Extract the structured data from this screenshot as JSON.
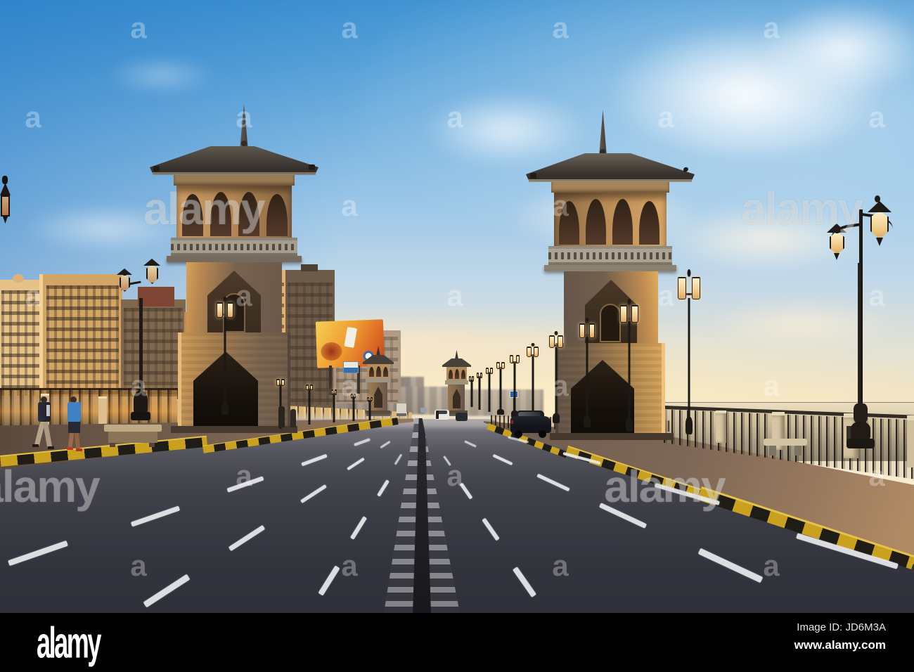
{
  "watermarks": {
    "brand_text": "alamy",
    "mark_text": "a"
  },
  "footer": {
    "logo_text": "alamy",
    "image_id": "Image ID: JD6M3A",
    "url": "www.alamy.com"
  },
  "scene": {
    "colors": {
      "sky_top": "#3f93d2",
      "sky_light": "#9ec8e8",
      "horizon_glow": "#f7ecd2",
      "asphalt_dark": "#2f3039",
      "asphalt_light": "#97959a",
      "curb_yellow": "#c9a11e",
      "curb_black": "#1f1c16",
      "tower_sunlit": "#cf9d5e",
      "tower_shadow": "#665448",
      "roof_dark": "#3b3631",
      "lantern_glow": "#f6dfae",
      "sea": "#cdbf9f",
      "footer_bg": "#000000",
      "footer_text": "#ffffff"
    }
  }
}
